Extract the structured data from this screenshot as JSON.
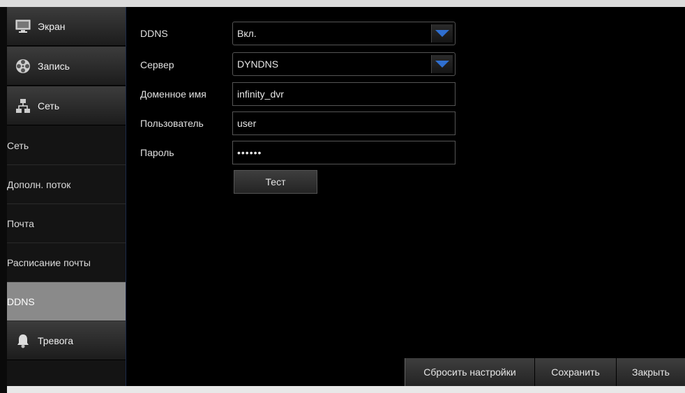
{
  "sidebar": {
    "categories": [
      {
        "label": "Экран",
        "icon": "monitor-icon"
      },
      {
        "label": "Запись",
        "icon": "film-reel-icon"
      },
      {
        "label": "Сеть",
        "icon": "network-icon"
      },
      {
        "label": "Тревога",
        "icon": "bell-icon"
      }
    ],
    "subitems": [
      "Сеть",
      "Дополн. поток",
      "Почта",
      "Расписание почты",
      "DDNS"
    ],
    "active_subitem": "DDNS"
  },
  "form": {
    "ddns": {
      "label": "DDNS",
      "value": "Вкл."
    },
    "server": {
      "label": "Сервер",
      "value": "DYNDNS"
    },
    "domain": {
      "label": "Доменное имя",
      "value": "infinity_dvr"
    },
    "user": {
      "label": "Пользователь",
      "value": "user"
    },
    "password": {
      "label": "Пароль",
      "value": "••••••"
    },
    "test_button": "Тест"
  },
  "footer": {
    "reset": "Сбросить настройки",
    "save": "Сохранить",
    "close": "Закрыть"
  },
  "colors": {
    "accent_arrow": "#2f6fd0",
    "active_item": "#8a8a8a"
  }
}
